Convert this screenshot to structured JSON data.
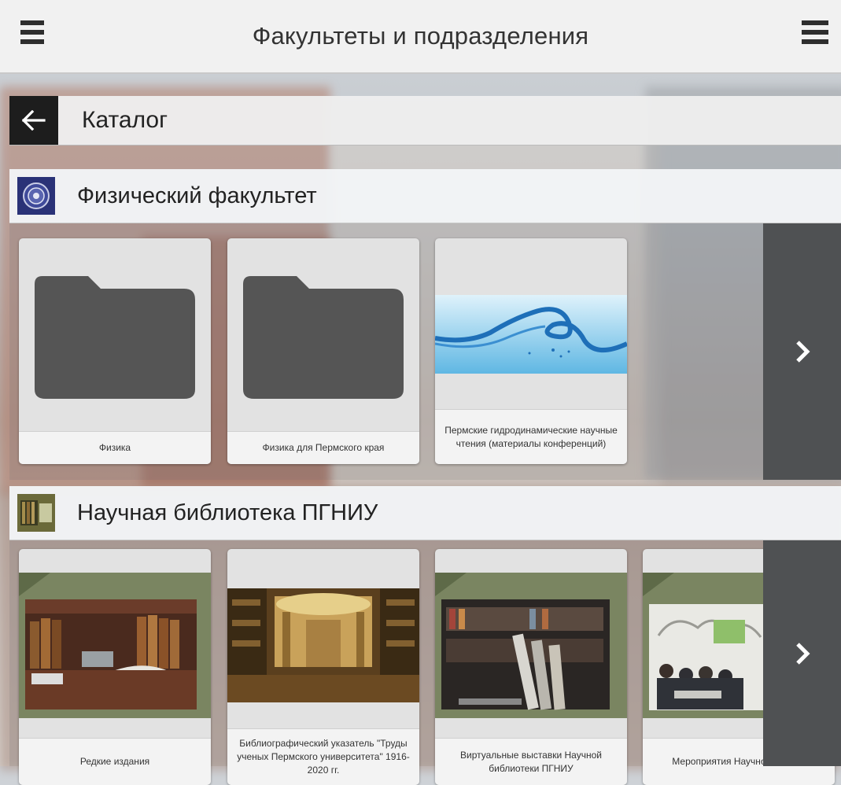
{
  "app": {
    "title": "Факультеты и подразделения"
  },
  "catalog": {
    "label": "Каталог"
  },
  "sections": [
    {
      "title": "Физический факультет",
      "cards": [
        {
          "label": "Физика",
          "kind": "folder-icon"
        },
        {
          "label": "Физика для Пермского края",
          "kind": "folder-icon"
        },
        {
          "label": "Пермские гидродинамические научные чтения (материалы конференций)",
          "kind": "water-wave-image"
        }
      ]
    },
    {
      "title": "Научная библиотека ПГНИУ",
      "cards": [
        {
          "label": "Редкие издания",
          "kind": "rare-books-image"
        },
        {
          "label": "Библиографический указатель \"Труды ученых Пермского университета\" 1916-2020 гг.",
          "kind": "library-hall-image"
        },
        {
          "label": "Виртуальные выставки Научной библиотеки ПГНИУ",
          "kind": "bookshelf-laptop-image"
        },
        {
          "label": "Мероприятия Научной ПГНИУ",
          "kind": "event-meeting-image"
        }
      ]
    }
  ],
  "colors": {
    "folder": "#555555",
    "back_button": "#1d1d1d",
    "next_panel": "#4f5153",
    "green_band": "#7a8561"
  }
}
